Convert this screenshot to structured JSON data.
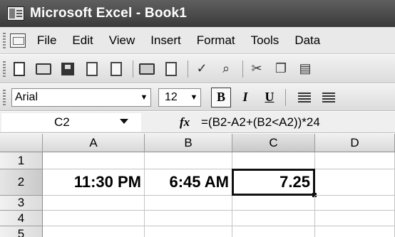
{
  "window": {
    "title": "Microsoft Excel - Book1"
  },
  "menu": [
    "File",
    "Edit",
    "View",
    "Insert",
    "Format",
    "Tools",
    "Data"
  ],
  "formatting": {
    "font": "Arial",
    "size": "12",
    "bold": "B",
    "italic": "I",
    "underline": "U"
  },
  "formula_bar": {
    "name_box": "C2",
    "fx": "fx",
    "formula": "=(B2-A2+(B2<A2))*24"
  },
  "grid": {
    "columns": [
      "A",
      "B",
      "C",
      "D"
    ],
    "rows": [
      "1",
      "2",
      "3",
      "4",
      "5"
    ],
    "active_cell": "C2",
    "cells": {
      "A2": "11:30 PM",
      "B2": "6:45 AM",
      "C2": "7.25"
    }
  }
}
